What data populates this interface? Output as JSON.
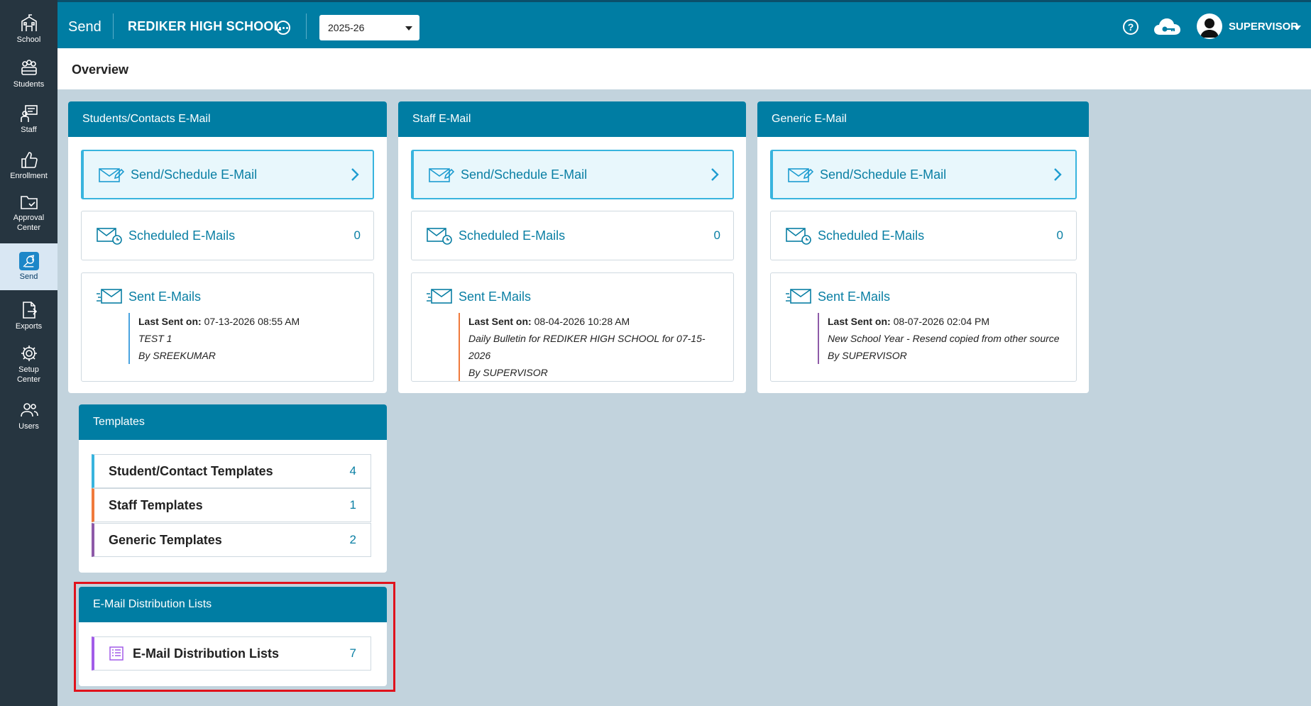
{
  "sidebar": {
    "items": [
      {
        "label": "School",
        "icon": "school-icon"
      },
      {
        "label": "Students",
        "icon": "students-icon"
      },
      {
        "label": "Staff",
        "icon": "staff-icon"
      },
      {
        "label": "Enrollment",
        "icon": "thumbs-up-icon"
      },
      {
        "label1": "Approval",
        "label2": "Center",
        "icon": "folder-icon"
      },
      {
        "label": "Send",
        "icon": "send-icon",
        "active": true
      },
      {
        "label": "Exports",
        "icon": "export-icon"
      },
      {
        "label1": "Setup",
        "label2": "Center",
        "icon": "gear-icon"
      },
      {
        "label": "Users",
        "icon": "users-icon"
      }
    ]
  },
  "header": {
    "module": "Send",
    "school": "REDIKER HIGH SCHOOL",
    "year": "2025-26",
    "user": "SUPERVISOR"
  },
  "page": {
    "title": "Overview"
  },
  "cards": [
    {
      "title": "Students/Contacts E-Mail",
      "send_label": "Send/Schedule E-Mail",
      "scheduled_label": "Scheduled E-Mails",
      "scheduled_count": "0",
      "sent_label": "Sent E-Mails",
      "last_sent_label": "Last Sent on:",
      "last_sent_time": "07-13-2026 08:55 AM",
      "subject": "TEST 1",
      "by": "By SREEKUMAR",
      "accent": "#4aa3df"
    },
    {
      "title": "Staff E-Mail",
      "send_label": "Send/Schedule E-Mail",
      "scheduled_label": "Scheduled E-Mails",
      "scheduled_count": "0",
      "sent_label": "Sent E-Mails",
      "last_sent_label": "Last Sent on:",
      "last_sent_time": "08-04-2026 10:28 AM",
      "subject": "Daily Bulletin for REDIKER HIGH SCHOOL for 07-15-2026",
      "by": "By SUPERVISOR",
      "accent": "#f07a3c"
    },
    {
      "title": "Generic E-Mail",
      "send_label": "Send/Schedule E-Mail",
      "scheduled_label": "Scheduled E-Mails",
      "scheduled_count": "0",
      "sent_label": "Sent E-Mails",
      "last_sent_label": "Last Sent on:",
      "last_sent_time": "08-07-2026 02:04 PM",
      "subject": "New School Year - Resend copied from other source",
      "by": "By SUPERVISOR",
      "accent": "#8e5aa8"
    }
  ],
  "templates": {
    "title": "Templates",
    "items": [
      {
        "label": "Student/Contact Templates",
        "count": "4",
        "accent": "#38b4de"
      },
      {
        "label": "Staff Templates",
        "count": "1",
        "accent": "#f07a3c"
      },
      {
        "label": "Generic Templates",
        "count": "2",
        "accent": "#8e5aa8"
      }
    ]
  },
  "distribution": {
    "title": "E-Mail Distribution Lists",
    "item_label": "E-Mail Distribution Lists",
    "count": "7",
    "accent": "#a25ce8"
  }
}
